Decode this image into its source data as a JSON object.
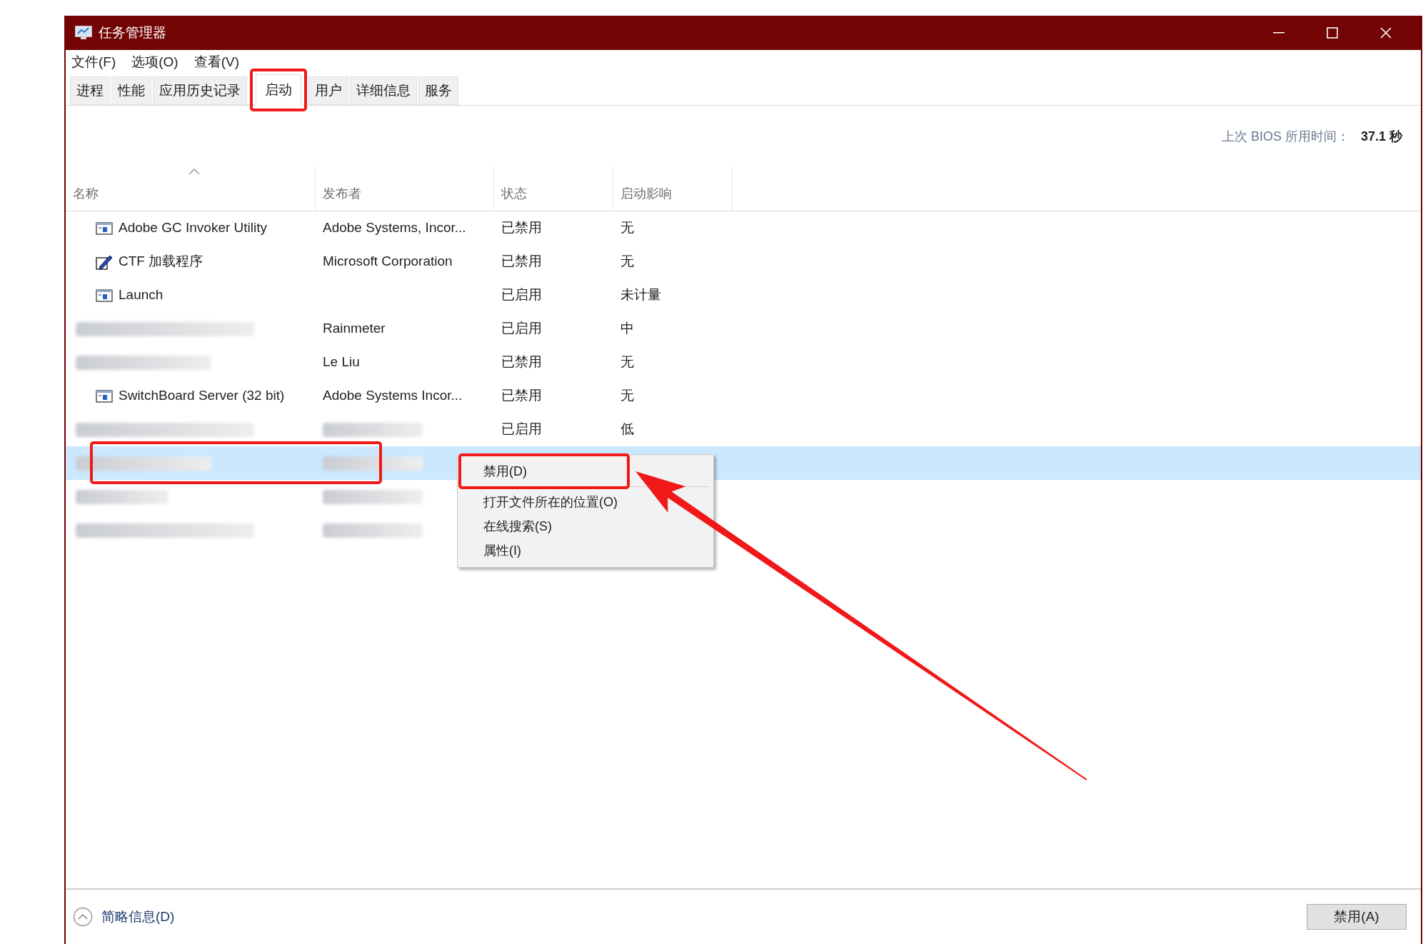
{
  "window": {
    "title": "任务管理器"
  },
  "menu": [
    "文件(F)",
    "选项(O)",
    "查看(V)"
  ],
  "tabs": [
    {
      "label": "进程",
      "selected": false
    },
    {
      "label": "性能",
      "selected": false
    },
    {
      "label": "应用历史记录",
      "selected": false
    },
    {
      "label": "启动",
      "selected": true
    },
    {
      "label": "用户",
      "selected": false
    },
    {
      "label": "详细信息",
      "selected": false
    },
    {
      "label": "服务",
      "selected": false
    }
  ],
  "bios": {
    "label": "上次 BIOS 所用时间：",
    "value": "37.1 秒"
  },
  "table": {
    "columns": [
      "名称",
      "发布者",
      "状态",
      "启动影响"
    ],
    "rows": [
      {
        "kind": "app",
        "name": "Adobe GC Invoker Utility",
        "publisher": "Adobe Systems, Incor...",
        "status": "已禁用",
        "impact": "无",
        "selected": false
      },
      {
        "kind": "pen",
        "name": "CTF 加载程序",
        "publisher": "Microsoft Corporation",
        "status": "已禁用",
        "impact": "无",
        "selected": false
      },
      {
        "kind": "app",
        "name": "Launch",
        "status": "已启用",
        "impact": "未计量",
        "selected": false
      },
      {
        "name_blurred": true,
        "publisher": "Rainmeter",
        "status": "已启用",
        "impact": "中",
        "selected": false
      },
      {
        "name_blurred": true,
        "publisher": "Le Liu",
        "status": "已禁用",
        "impact": "无",
        "selected": false
      },
      {
        "kind": "app",
        "name": "SwitchBoard Server (32 bit)",
        "publisher": "Adobe Systems Incor...",
        "status": "已禁用",
        "impact": "无",
        "selected": false
      },
      {
        "name_blurred": true,
        "publisher_blurred": true,
        "status": "已启用",
        "impact": "低",
        "selected": false
      },
      {
        "name_blurred": true,
        "publisher_blurred": true,
        "selected": true
      },
      {
        "name_blurred": true,
        "publisher_blurred": true,
        "selected": false
      },
      {
        "name_blurred": true,
        "publisher_blurred": true,
        "selected": false
      }
    ]
  },
  "context_menu": [
    "禁用(D)",
    "打开文件所在的位置(O)",
    "在线搜索(S)",
    "属性(I)"
  ],
  "footer": {
    "details_toggle": "简略信息(D)",
    "button": "禁用(A)"
  },
  "annotations": [
    {
      "kind": "box"
    },
    {
      "kind": "box"
    },
    {
      "kind": "box"
    },
    {
      "kind": "arrow"
    }
  ]
}
